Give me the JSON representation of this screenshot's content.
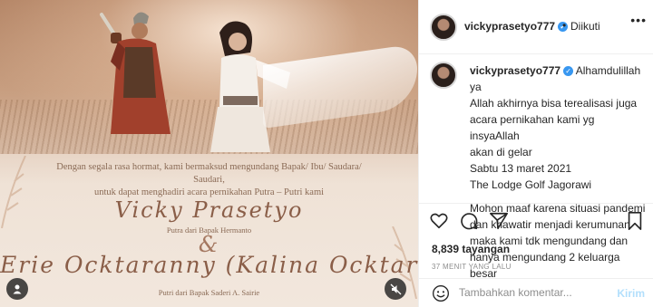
{
  "media": {
    "intro_line1": "Dengan segala rasa hormat, kami bermaksud mengundang Bapak/ Ibu/ Saudara/ Saudari,",
    "intro_line2": "untuk dapat menghadiri acara pernikahan Putra – Putri kami",
    "groom_name": "Vicky Prasetyo",
    "groom_parent": "Putra dari Bapak Hermanto",
    "ampersand": "&",
    "bride_name": "Erie Ocktaranny (Kalina Ocktaranny)",
    "bride_parent": "Putri dari Bapak Saderi A. Sairie",
    "left_control_icon": "user-tag-icon",
    "right_control_icon": "mute-icon"
  },
  "header": {
    "username": "vickyprasetyo777",
    "separator": "•",
    "follow_label": "Diikuti",
    "more_label": "•••"
  },
  "caption": {
    "username": "vickyprasetyo777",
    "text_line1": " Alhamdulillah ya",
    "text_line2": "Allah akhirnya bisa terealisasi juga",
    "text_line3": "acara pernikahan kami yg insyaAllah",
    "text_line4": "akan di gelar",
    "text_line5": "Sabtu 13 maret 2021",
    "text_line6": "The Lodge Golf Jagorawi",
    "text_line7": "Mohon maaf karena situasi pandemi",
    "text_line8": "dan khawatir menjadi kerumunan",
    "text_line9": "maka kami tdk mengundang dan",
    "text_line10": "hanya mengundang 2 keluarga besar"
  },
  "stats": {
    "views": "8,839 tayangan",
    "time_ago": "37 MENIT YANG LALU"
  },
  "comment_box": {
    "placeholder": "Tambahkan komentar...",
    "send_label": "Kirim"
  },
  "colors": {
    "verified": "#3897f0",
    "send_disabled": "#b2dffc",
    "text_primary": "#262626",
    "text_secondary": "#8e8e8e"
  }
}
